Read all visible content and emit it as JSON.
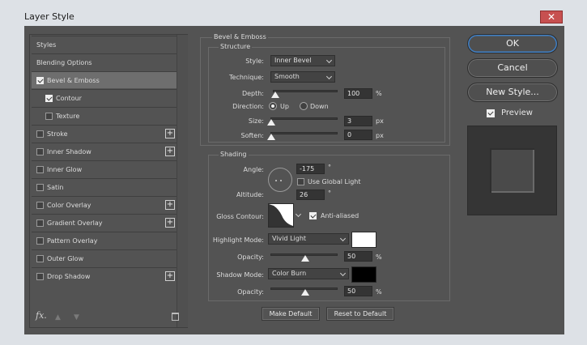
{
  "window": {
    "title": "Layer Style",
    "close_icon": "close-icon"
  },
  "styles_panel": {
    "items": [
      {
        "label": "Styles",
        "checkbox": false
      },
      {
        "label": "Blending Options",
        "checkbox": false
      },
      {
        "label": "Bevel & Emboss",
        "checkbox": true,
        "checked": true,
        "selected": true
      },
      {
        "label": "Contour",
        "checkbox": true,
        "checked": true,
        "sub": true
      },
      {
        "label": "Texture",
        "checkbox": true,
        "checked": false,
        "sub": true
      },
      {
        "label": "Stroke",
        "checkbox": true,
        "checked": false,
        "add": true
      },
      {
        "label": "Inner Shadow",
        "checkbox": true,
        "checked": false,
        "add": true
      },
      {
        "label": "Inner Glow",
        "checkbox": true,
        "checked": false
      },
      {
        "label": "Satin",
        "checkbox": true,
        "checked": false
      },
      {
        "label": "Color Overlay",
        "checkbox": true,
        "checked": false,
        "add": true
      },
      {
        "label": "Gradient Overlay",
        "checkbox": true,
        "checked": false,
        "add": true
      },
      {
        "label": "Pattern Overlay",
        "checkbox": true,
        "checked": false
      },
      {
        "label": "Outer Glow",
        "checkbox": true,
        "checked": false
      },
      {
        "label": "Drop Shadow",
        "checkbox": true,
        "checked": false,
        "add": true
      }
    ],
    "footer": {
      "fx_label": "fx",
      "fx_dot": "."
    }
  },
  "bevel": {
    "section_title": "Bevel & Emboss",
    "structure_title": "Structure",
    "style_label": "Style:",
    "style_value": "Inner Bevel",
    "technique_label": "Technique:",
    "technique_value": "Smooth",
    "depth_label": "Depth:",
    "depth_value": "100",
    "depth_unit": "%",
    "depth_fraction": 0.02,
    "direction_label": "Direction:",
    "up_label": "Up",
    "down_label": "Down",
    "direction_value": "Up",
    "size_label": "Size:",
    "size_value": "3",
    "size_unit": "px",
    "size_fraction": 0.0,
    "soften_label": "Soften:",
    "soften_value": "0",
    "soften_unit": "px",
    "soften_fraction": 0.0
  },
  "shading": {
    "title": "Shading",
    "angle_label": "Angle:",
    "angle_value": "-175",
    "angle_unit": "°",
    "global_light_label": "Use Global Light",
    "global_light_checked": false,
    "altitude_label": "Altitude:",
    "altitude_value": "26",
    "altitude_unit": "°",
    "gloss_label": "Gloss Contour:",
    "antialiased_label": "Anti-aliased",
    "antialiased_checked": true,
    "highlight_mode_label": "Highlight Mode:",
    "highlight_mode_value": "Vivid Light",
    "highlight_color": "#ffffff",
    "highlight_opacity_label": "Opacity:",
    "highlight_opacity_value": "50",
    "highlight_opacity_unit": "%",
    "highlight_opacity_fraction": 0.5,
    "shadow_mode_label": "Shadow Mode:",
    "shadow_mode_value": "Color Burn",
    "shadow_color": "#000000",
    "shadow_opacity_label": "Opacity:",
    "shadow_opacity_value": "50",
    "shadow_opacity_unit": "%",
    "shadow_opacity_fraction": 0.5
  },
  "actions": {
    "make_default": "Make Default",
    "reset_default": "Reset to Default"
  },
  "right": {
    "ok": "OK",
    "cancel": "Cancel",
    "new_style": "New Style...",
    "preview_label": "Preview",
    "preview_checked": true
  }
}
